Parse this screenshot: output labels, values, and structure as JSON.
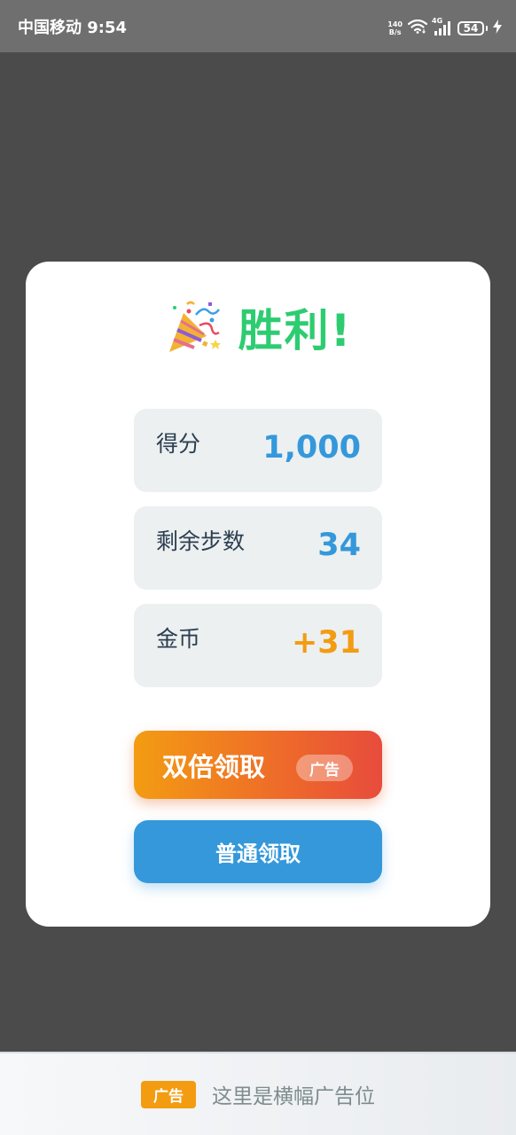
{
  "status_bar": {
    "carrier_time": "中国移动 9:54",
    "net_speed_value": "140",
    "net_speed_unit": "B/s",
    "network_type": "4G",
    "battery": "54",
    "icons": [
      "wifi-icon",
      "signal-icon",
      "battery-icon",
      "charging-icon"
    ]
  },
  "dialog": {
    "title_icon": "party-popper-icon",
    "title": "胜利!",
    "stats": [
      {
        "label": "得分",
        "value": "1,000"
      },
      {
        "label": "剩余步数",
        "value": "34"
      },
      {
        "label": "金币",
        "value": "+31"
      }
    ],
    "double_button_label": "双倍领取",
    "double_button_badge": "广告",
    "normal_button_label": "普通领取"
  },
  "banner": {
    "tag": "广告",
    "text": "这里是横幅广告位"
  },
  "colors": {
    "overlay": "#4b4b4b",
    "status_bar": "#6f6f6f",
    "title_green": "#2ecc71",
    "stat_blue": "#3498db",
    "coin_orange": "#f39c12",
    "gradient_end": "#e74c3c",
    "card_bg": "#ffffff",
    "stat_bg": "#ecf0f1"
  }
}
